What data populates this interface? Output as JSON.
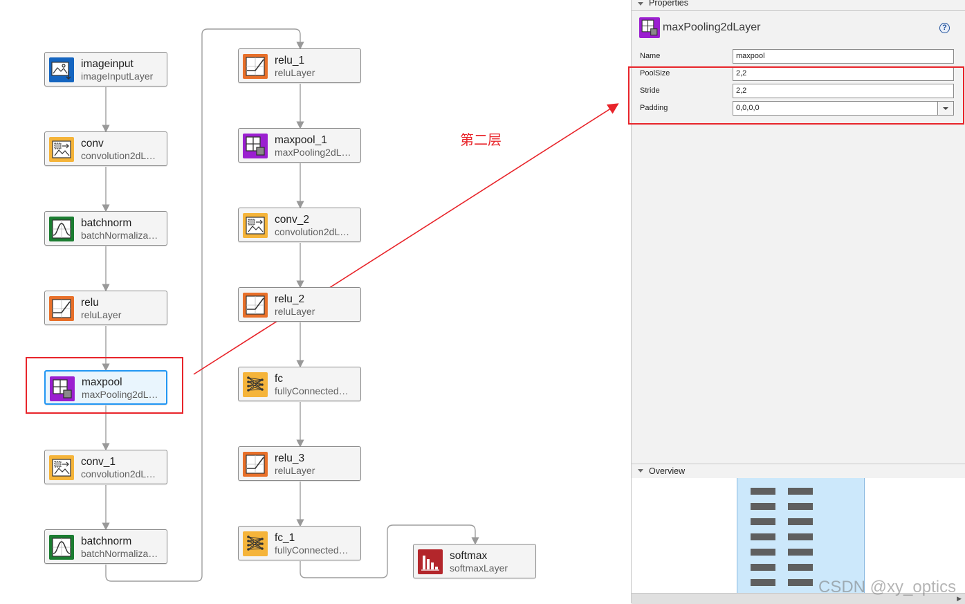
{
  "layers": [
    {
      "id": "imageinput",
      "name": "imageinput",
      "type": "imageInputLayer",
      "icon": "image-input-icon",
      "color": "#1565c0"
    },
    {
      "id": "conv",
      "name": "conv",
      "type": "convolution2dL…",
      "icon": "convolution-icon",
      "color": "#f5b43a"
    },
    {
      "id": "batchnorm",
      "name": "batchnorm",
      "type": "batchNormaliza…",
      "icon": "batchnorm-icon",
      "color": "#1b7d31"
    },
    {
      "id": "relu",
      "name": "relu",
      "type": "reluLayer",
      "icon": "relu-icon",
      "color": "#e8702a"
    },
    {
      "id": "maxpool",
      "name": "maxpool",
      "type": "maxPooling2dL…",
      "icon": "maxpool-icon",
      "color": "#9b1fd0"
    },
    {
      "id": "conv_1",
      "name": "conv_1",
      "type": "convolution2dL…",
      "icon": "convolution-icon",
      "color": "#f5b43a"
    },
    {
      "id": "batchnorm_1",
      "name": "batchnorm",
      "type": "batchNormaliza…",
      "icon": "batchnorm-icon",
      "color": "#1b7d31"
    },
    {
      "id": "relu_1",
      "name": "relu_1",
      "type": "reluLayer",
      "icon": "relu-icon",
      "color": "#e8702a"
    },
    {
      "id": "maxpool_1",
      "name": "maxpool_1",
      "type": "maxPooling2dL…",
      "icon": "maxpool-icon",
      "color": "#9b1fd0"
    },
    {
      "id": "conv_2",
      "name": "conv_2",
      "type": "convolution2dL…",
      "icon": "convolution-icon",
      "color": "#f5b43a"
    },
    {
      "id": "relu_2",
      "name": "relu_2",
      "type": "reluLayer",
      "icon": "relu-icon",
      "color": "#e8702a"
    },
    {
      "id": "fc",
      "name": "fc",
      "type": "fullyConnected…",
      "icon": "fully-connected-icon",
      "color": "#f5b43a"
    },
    {
      "id": "relu_3",
      "name": "relu_3",
      "type": "reluLayer",
      "icon": "relu-icon",
      "color": "#e8702a"
    },
    {
      "id": "fc_1",
      "name": "fc_1",
      "type": "fullyConnected…",
      "icon": "fully-connected-icon",
      "color": "#f5b43a"
    },
    {
      "id": "softmax",
      "name": "softmax",
      "type": "softmaxLayer",
      "icon": "softmax-icon",
      "color": "#b3262b"
    }
  ],
  "selected_layer": "maxpool",
  "annotation": {
    "text": "第二层",
    "color": "#e8242a"
  },
  "properties": {
    "header": "Properties",
    "layer_type": "maxPooling2dLayer",
    "layer_icon": "maxpool-icon",
    "help_label": "?",
    "fields": [
      {
        "label": "Name",
        "value": "maxpool",
        "kind": "text"
      },
      {
        "label": "PoolSize",
        "value": "2,2",
        "kind": "text"
      },
      {
        "label": "Stride",
        "value": "2,2",
        "kind": "text"
      },
      {
        "label": "Padding",
        "value": "0,0,0,0",
        "kind": "dropdown"
      }
    ]
  },
  "overview": {
    "header": "Overview"
  },
  "watermark": "CSDN @xy_optics",
  "accent_colors": {
    "selection": "#2196f3",
    "annotation": "#e8242a",
    "viewport": "#cce8fb"
  }
}
